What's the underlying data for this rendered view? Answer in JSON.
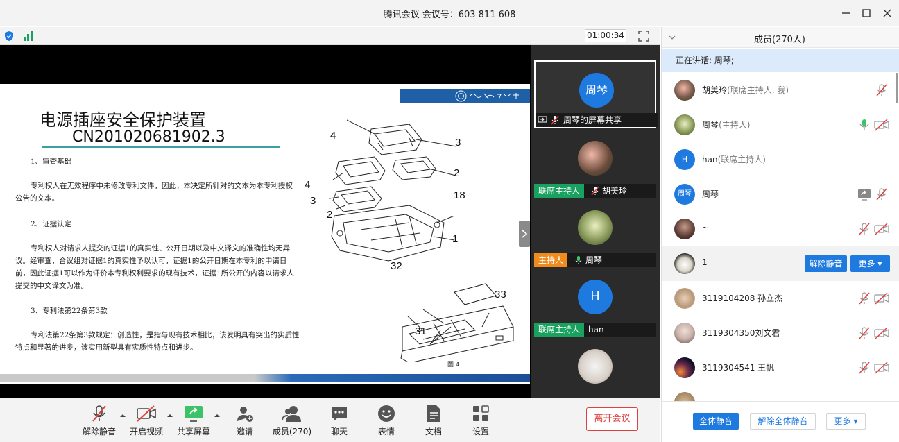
{
  "window": {
    "title": "腾讯会议 会议号：603 811 608"
  },
  "status": {
    "timer": "01:00:34"
  },
  "slide": {
    "title": "电源插座安全保护装置",
    "subtitle": "CN201020681902.3",
    "p1_head": "1、审查基础",
    "p1_body": "专利权人在无效程序中未修改专利文件，因此，本决定所针对的文本为本专利授权公告的文本。",
    "p2_head": "2、证据认定",
    "p2_body": "专利权人对请求人提交的证据1的真实性、公开日期以及中文译文的准确性均无异议。经审查，合议组对证据1的真实性予以认可，证据1的公开日期在本专利的申请日前，因此证据1可以作为评价本专利权利要求的现有技术，证据1所公开的内容以请求人提交的中文译文为准。",
    "p3_head": "3、专利法第22条第3款",
    "p3_body": "专利法第22条第3款规定：创造性，是指与现有技术相比，该发明具有突出的实质性特点和显著的进步，该实用新型具有实质性特点和进步。",
    "fig_labels": [
      "4",
      "3",
      "2",
      "4",
      "3",
      "2",
      "18",
      "1",
      "32",
      "33",
      "31"
    ],
    "fig_caption": "图 4"
  },
  "videos": [
    {
      "avatar_text": "周琴",
      "label": "周琴的屏幕共享",
      "role": ""
    },
    {
      "avatar_text": "",
      "label": "胡美玲",
      "role": "联席主持人"
    },
    {
      "avatar_text": "",
      "label": "周琴",
      "role": "主持人"
    },
    {
      "avatar_text": "H",
      "label": "han",
      "role": "联席主持人"
    }
  ],
  "toolbar": {
    "mute": "解除静音",
    "video": "开启视频",
    "share": "共享屏幕",
    "invite": "邀请",
    "members": "成员(270)",
    "chat": "聊天",
    "emoji": "表情",
    "docs": "文档",
    "settings": "设置",
    "leave": "离开会议"
  },
  "panel": {
    "header": "成员(270人)",
    "speaking": "正在讲话: 周琴;",
    "members": [
      {
        "name": "胡美玲",
        "role": "(联席主持人, 我)",
        "avatar": ""
      },
      {
        "name": "周琴",
        "role": "(主持人)",
        "avatar": ""
      },
      {
        "name": "han",
        "role": "(联席主持人)",
        "avatar": "H"
      },
      {
        "name": "周琴",
        "role": "",
        "avatar": "周琴"
      },
      {
        "name": "~",
        "role": "",
        "avatar": ""
      },
      {
        "name": "1",
        "role": "",
        "avatar": ""
      },
      {
        "name": "3119104208 孙立杰",
        "role": "",
        "avatar": ""
      },
      {
        "name": "3119304350刘文君",
        "role": "",
        "avatar": ""
      },
      {
        "name": "3119304541 王帆",
        "role": "",
        "avatar": ""
      }
    ],
    "unmute_btn": "解除静音",
    "more_btn": "更多 ▾",
    "mute_all": "全体静音",
    "unmute_all": "解除全体静音",
    "more_footer": "更多 ▾"
  },
  "colors": {
    "accent": "#1f7ae0",
    "cohost": "#19a15f",
    "host": "#f08c1d",
    "danger": "#e04040"
  }
}
